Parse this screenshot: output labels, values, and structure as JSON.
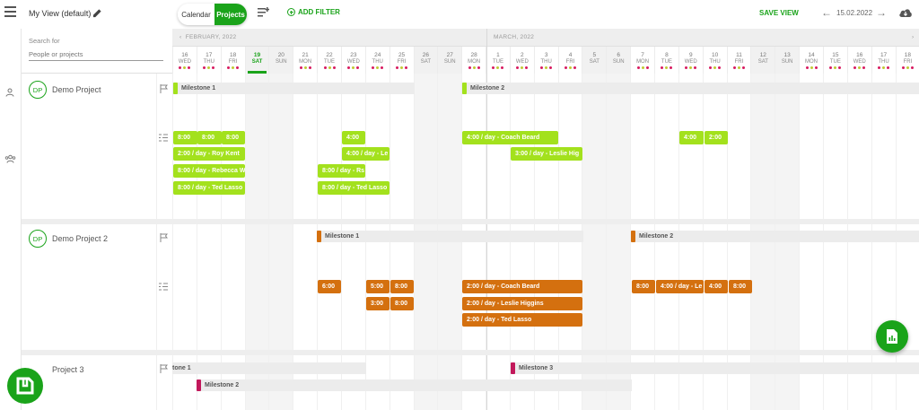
{
  "topbar": {
    "view_name": "My View (default)",
    "toggle_calendar": "Calendar",
    "toggle_projects": "Projects",
    "add_filter": "ADD FILTER",
    "save_view": "SAVE VIEW",
    "current_date": "15.02.2022"
  },
  "search": {
    "label": "Search for",
    "placeholder": "People or projects"
  },
  "months": [
    "FEBRUARY, 2022",
    "MARCH, 2022"
  ],
  "days": [
    {
      "n": "16",
      "w": "WED"
    },
    {
      "n": "17",
      "w": "THU"
    },
    {
      "n": "18",
      "w": "FRI"
    },
    {
      "n": "19",
      "w": "SAT"
    },
    {
      "n": "20",
      "w": "SUN"
    },
    {
      "n": "21",
      "w": "MON"
    },
    {
      "n": "22",
      "w": "TUE"
    },
    {
      "n": "23",
      "w": "WED"
    },
    {
      "n": "24",
      "w": "THU"
    },
    {
      "n": "25",
      "w": "FRI"
    },
    {
      "n": "26",
      "w": "SAT"
    },
    {
      "n": "27",
      "w": "SUN"
    },
    {
      "n": "28",
      "w": "MON"
    },
    {
      "n": "1",
      "w": "TUE"
    },
    {
      "n": "2",
      "w": "WED"
    },
    {
      "n": "3",
      "w": "THU"
    },
    {
      "n": "4",
      "w": "FRI"
    },
    {
      "n": "5",
      "w": "SAT"
    },
    {
      "n": "6",
      "w": "SUN"
    },
    {
      "n": "7",
      "w": "MON"
    },
    {
      "n": "8",
      "w": "TUE"
    },
    {
      "n": "9",
      "w": "WED"
    },
    {
      "n": "10",
      "w": "THU"
    },
    {
      "n": "11",
      "w": "FRI"
    },
    {
      "n": "12",
      "w": "SAT"
    },
    {
      "n": "13",
      "w": "SUN"
    },
    {
      "n": "14",
      "w": "MON"
    },
    {
      "n": "15",
      "w": "TUE"
    },
    {
      "n": "16",
      "w": "WED"
    },
    {
      "n": "17",
      "w": "THU"
    },
    {
      "n": "18",
      "w": "FRI"
    }
  ],
  "colors": {
    "accent": "#1aa31a",
    "green_bar": "#a3e11d",
    "orange_bar": "#d4700f",
    "magenta": "#c2185b",
    "dot_red": "#d81b60",
    "dot_yellow": "#c0ca33",
    "dot_olive": "#9e9d24"
  },
  "projects": [
    {
      "initials": "DP",
      "name": "Demo Project",
      "milestones": [
        "Milestone 1",
        "Milestone 2"
      ],
      "bookings": [
        "8:00",
        "8:00",
        "8:00",
        "4:00",
        "4:00 / day - Coach Beard",
        "4:00",
        "2:00",
        "2:00 / day - Roy Kent",
        "4:00 / day - Le",
        "3:00 / day - Leslie Hig",
        "8:00 / day - Rebecca W",
        "8:00 / day - Rs",
        "8:00 / day - Ted Lasso",
        "8:00 / day - Ted Lasso"
      ]
    },
    {
      "initials": "DP",
      "name": "Demo Project 2",
      "milestones": [
        "Milestone 1",
        "Milestone 2"
      ],
      "bookings": [
        "6:00",
        "5:00",
        "8:00",
        "2:00 / day - Coach Beard",
        "8:00",
        "4:00 / day - Le",
        "4:00",
        "8:00",
        "3:00",
        "8:00",
        "2:00 / day - Leslie Higgins",
        "2:00 / day - Ted Lasso"
      ]
    },
    {
      "name": "Project 3",
      "milestones": [
        "tone 1",
        "Milestone 3",
        "Milestone 2"
      ]
    }
  ]
}
